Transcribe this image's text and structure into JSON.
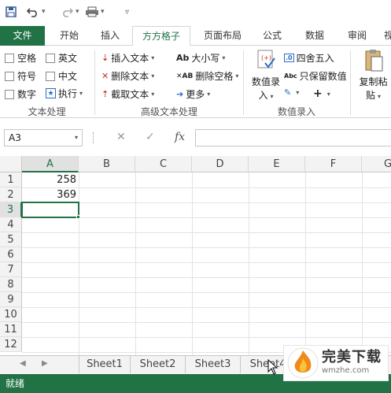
{
  "qat": {
    "save_icon": "save-icon",
    "undo_icon": "undo-icon",
    "redo_icon": "redo-icon",
    "customize_icon": "customize-icon"
  },
  "tabs": [
    {
      "label": "文件"
    },
    {
      "label": "开始"
    },
    {
      "label": "插入"
    },
    {
      "label": "方方格子"
    },
    {
      "label": "页面布局"
    },
    {
      "label": "公式"
    },
    {
      "label": "数据"
    },
    {
      "label": "审阅"
    },
    {
      "label": "视"
    }
  ],
  "ribbon": {
    "text_group": {
      "label": "文本处理",
      "items": [
        "空格",
        "英文",
        "符号",
        "中文",
        "数字"
      ],
      "execute": "执行"
    },
    "advanced_group": {
      "label": "高级文本处理",
      "insert_text": "插入文本",
      "delete_text": "删除文本",
      "extract_text": "截取文本",
      "case": "大小写",
      "delete_space": "删除空格",
      "more": "更多"
    },
    "number_group": {
      "label": "数值录入",
      "number_entry": "数值录",
      "number_entry_2": "入",
      "round": "四舍五入",
      "keep_values": "只保留数值"
    },
    "paste_group": {
      "copy_paste": "复制粘",
      "copy_paste_2": "贴"
    }
  },
  "formula_bar": {
    "name_box": "A3",
    "fx": "fx",
    "value": ""
  },
  "grid": {
    "columns": [
      "A",
      "B",
      "C",
      "D",
      "E",
      "F",
      "G"
    ],
    "rows": [
      "1",
      "2",
      "3",
      "4",
      "5",
      "6",
      "7",
      "8",
      "9",
      "10",
      "11",
      "12"
    ],
    "cells": {
      "A1": "258",
      "A2": "369"
    },
    "active_cell": "A3"
  },
  "sheets": [
    "Sheet1",
    "Sheet2",
    "Sheet3",
    "Sheet4"
  ],
  "status": {
    "text": "就绪"
  },
  "watermark": {
    "title": "完美下载",
    "url": "wmzhe.com"
  },
  "colors": {
    "accent": "#217346"
  }
}
